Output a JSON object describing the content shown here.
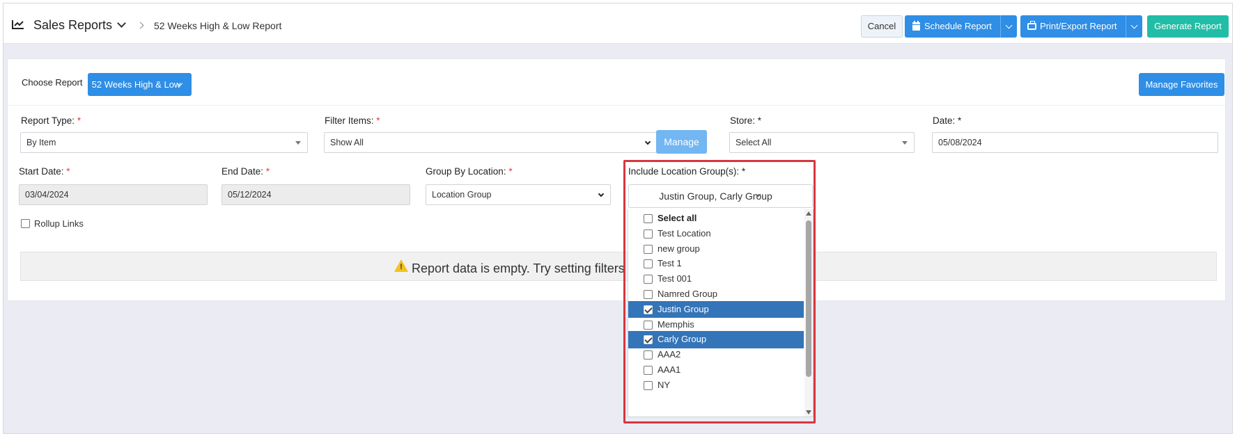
{
  "header": {
    "title": "Sales Reports",
    "breadcrumb": "52 Weeks High & Low Report",
    "cancel_label": "Cancel",
    "schedule_label": "Schedule Report",
    "print_label": "Print/Export Report",
    "generate_label": "Generate Report"
  },
  "chooser": {
    "label": "Choose Report",
    "selected": "52 Weeks High & Low",
    "favorites_label": "Manage Favorites"
  },
  "filters": {
    "report_type_label": "Report Type:",
    "report_type_value": "By Item",
    "filter_items_label": "Filter Items:",
    "filter_items_value": "Show All",
    "manage_label": "Manage",
    "store_label": "Store:",
    "store_value": "Select All",
    "date_label": "Date:",
    "date_value": "05/08/2024",
    "start_date_label": "Start Date:",
    "start_date_value": "03/04/2024",
    "end_date_label": "End Date:",
    "end_date_value": "05/12/2024",
    "group_by_label": "Group By Location:",
    "group_by_value": "Location Group",
    "include_groups_label": "Include Location Group(s):",
    "include_groups_value": "Justin Group, Carly Group",
    "rollup_label": "Rollup Links",
    "required_mark": "*"
  },
  "empty_message": "Report data is empty. Try setting filters to find results.",
  "location_groups": [
    {
      "label": "Select all",
      "checked": false
    },
    {
      "label": "Test Location",
      "checked": false
    },
    {
      "label": "new group",
      "checked": false
    },
    {
      "label": "Test 1",
      "checked": false
    },
    {
      "label": "Test 001",
      "checked": false
    },
    {
      "label": "Namred Group",
      "checked": false
    },
    {
      "label": "Justin Group",
      "checked": true
    },
    {
      "label": "Memphis",
      "checked": false
    },
    {
      "label": "Carly Group",
      "checked": true
    },
    {
      "label": "AAA2",
      "checked": false
    },
    {
      "label": "AAA1",
      "checked": false
    },
    {
      "label": "NY",
      "checked": false
    }
  ],
  "colors": {
    "primary": "#2f8ee5",
    "teal": "#22bda6",
    "selected_row": "#3474b8",
    "highlight": "#d9363e"
  }
}
